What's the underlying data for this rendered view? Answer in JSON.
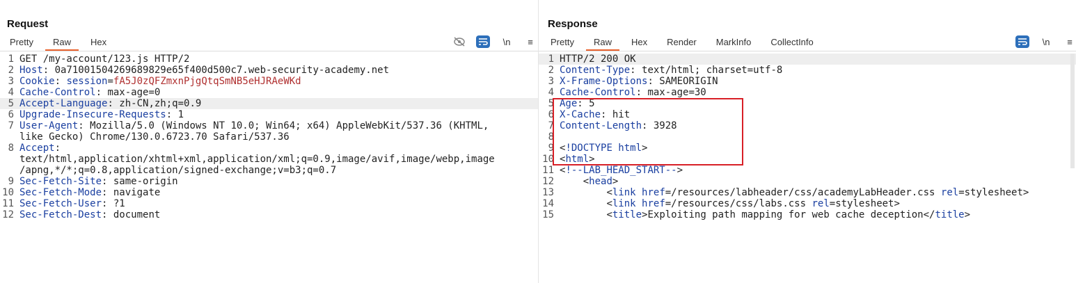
{
  "request": {
    "title": "Request",
    "tabs": [
      "Pretty",
      "Raw",
      "Hex"
    ],
    "tools": {
      "newline_label": "\\n",
      "menu_glyph": "≡"
    },
    "lines": [
      {
        "n": "1",
        "key": "",
        "val": "GET /my-account/123.js HTTP/2",
        "vclass": ""
      },
      {
        "n": "2",
        "key": "Host",
        "val": "0a71001504269689829e65f400d500c7.web-security-academy.net",
        "vclass": ""
      },
      {
        "n": "3",
        "key": "Cookie",
        "val": "session=fA5J0zQFZmxnPjgQtqSmNB5eHJRAeWKd",
        "vclass": "cookie"
      },
      {
        "n": "4",
        "key": "Cache-Control",
        "val": "max-age=0",
        "vclass": ""
      },
      {
        "n": "5",
        "key": "Accept-Language",
        "val": "zh-CN,zh;q=0.9",
        "vclass": "",
        "highlight": true
      },
      {
        "n": "6",
        "key": "Upgrade-Insecure-Requests",
        "val": "1",
        "vclass": ""
      },
      {
        "n": "7",
        "key": "User-Agent",
        "val": "Mozilla/5.0 (Windows NT 10.0; Win64; x64) AppleWebKit/537.36 (KHTML,",
        "vclass": ""
      },
      {
        "n": "",
        "key": "",
        "val": "like Gecko) Chrome/130.0.6723.70 Safari/537.36",
        "vclass": ""
      },
      {
        "n": "8",
        "key": "Accept",
        "val": "",
        "vclass": ""
      },
      {
        "n": "",
        "key": "",
        "val": "text/html,application/xhtml+xml,application/xml;q=0.9,image/avif,image/webp,image",
        "vclass": ""
      },
      {
        "n": "",
        "key": "",
        "val": "/apng,*/*;q=0.8,application/signed-exchange;v=b3;q=0.7",
        "vclass": ""
      },
      {
        "n": "9",
        "key": "Sec-Fetch-Site",
        "val": "same-origin",
        "vclass": ""
      },
      {
        "n": "10",
        "key": "Sec-Fetch-Mode",
        "val": "navigate",
        "vclass": ""
      },
      {
        "n": "11",
        "key": "Sec-Fetch-User",
        "val": "?1",
        "vclass": ""
      },
      {
        "n": "12",
        "key": "Sec-Fetch-Dest",
        "val": "document",
        "vclass": ""
      }
    ]
  },
  "response": {
    "title": "Response",
    "tabs": [
      "Pretty",
      "Raw",
      "Hex",
      "Render",
      "MarkInfo",
      "CollectInfo"
    ],
    "tools": {
      "newline_label": "\\n",
      "menu_glyph": "≡"
    },
    "lines": [
      {
        "n": "1",
        "key": "",
        "val": "HTTP/2 200 OK",
        "highlight": true
      },
      {
        "n": "2",
        "key": "Content-Type",
        "val": "text/html; charset=utf-8"
      },
      {
        "n": "3",
        "key": "X-Frame-Options",
        "val": "SAMEORIGIN"
      },
      {
        "n": "4",
        "key": "Cache-Control",
        "val": "max-age=30"
      },
      {
        "n": "5",
        "key": "Age",
        "val": "5"
      },
      {
        "n": "6",
        "key": "X-Cache",
        "val": "hit"
      },
      {
        "n": "7",
        "key": "Content-Length",
        "val": "3928"
      },
      {
        "n": "8",
        "key": "",
        "val": ""
      },
      {
        "n": "9",
        "html": [
          [
            "p",
            "<"
          ],
          [
            "t",
            "!DOCTYPE html"
          ],
          [
            "p",
            ">"
          ]
        ],
        "indent": ""
      },
      {
        "n": "10",
        "html": [
          [
            "p",
            "<"
          ],
          [
            "t",
            "html"
          ],
          [
            "p",
            ">"
          ]
        ],
        "indent": ""
      },
      {
        "n": "11",
        "html": [
          [
            "p",
            "<"
          ],
          [
            "t",
            "!--LAB_HEAD_START--"
          ],
          [
            "p",
            ">"
          ]
        ],
        "indent": ""
      },
      {
        "n": "12",
        "html": [
          [
            "p",
            "<"
          ],
          [
            "t",
            "head"
          ],
          [
            "p",
            ">"
          ]
        ],
        "indent": "    "
      },
      {
        "n": "13",
        "html": [
          [
            "p",
            "<"
          ],
          [
            "t",
            "link "
          ],
          [
            "a",
            "href"
          ],
          [
            "p",
            "=/resources/labheader/css/academyLabHeader.css "
          ],
          [
            "a",
            "rel"
          ],
          [
            "p",
            "=stylesheet>"
          ]
        ],
        "indent": "        "
      },
      {
        "n": "14",
        "html": [
          [
            "p",
            "<"
          ],
          [
            "t",
            "link "
          ],
          [
            "a",
            "href"
          ],
          [
            "p",
            "=/resources/css/labs.css "
          ],
          [
            "a",
            "rel"
          ],
          [
            "p",
            "=stylesheet>"
          ]
        ],
        "indent": "        "
      },
      {
        "n": "15",
        "html": [
          [
            "p",
            "<"
          ],
          [
            "t",
            "title"
          ],
          [
            "p",
            ">Exploiting path mapping for web cache deception</"
          ],
          [
            "t",
            "title"
          ],
          [
            "p",
            ">"
          ]
        ],
        "indent": "        "
      }
    ]
  },
  "colors": {
    "accent": "#e8612c",
    "highlight_box": "#d81f26",
    "header_key": "#1a3fa0",
    "cookie_value": "#b03030",
    "tool_active": "#2d6fba"
  }
}
